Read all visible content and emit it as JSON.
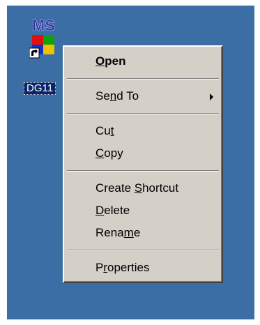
{
  "desktop": {
    "background_color": "#3a6ea5",
    "shortcut": {
      "icon": "msdos-shortcut-icon",
      "icon_text": "MS",
      "label": "DG11"
    }
  },
  "context_menu": {
    "items": [
      {
        "label": "Open",
        "mnemonic_index": 0,
        "default": true
      },
      {
        "label": "Send To",
        "mnemonic_index": 2,
        "submenu": true
      },
      {
        "label": "Cut",
        "mnemonic_index": 2
      },
      {
        "label": "Copy",
        "mnemonic_index": 0
      },
      {
        "label": "Create Shortcut",
        "mnemonic_index": 7
      },
      {
        "label": "Delete",
        "mnemonic_index": 0
      },
      {
        "label": "Rename",
        "mnemonic_index": 4
      },
      {
        "label": "Properties",
        "mnemonic_index": 1
      }
    ]
  }
}
